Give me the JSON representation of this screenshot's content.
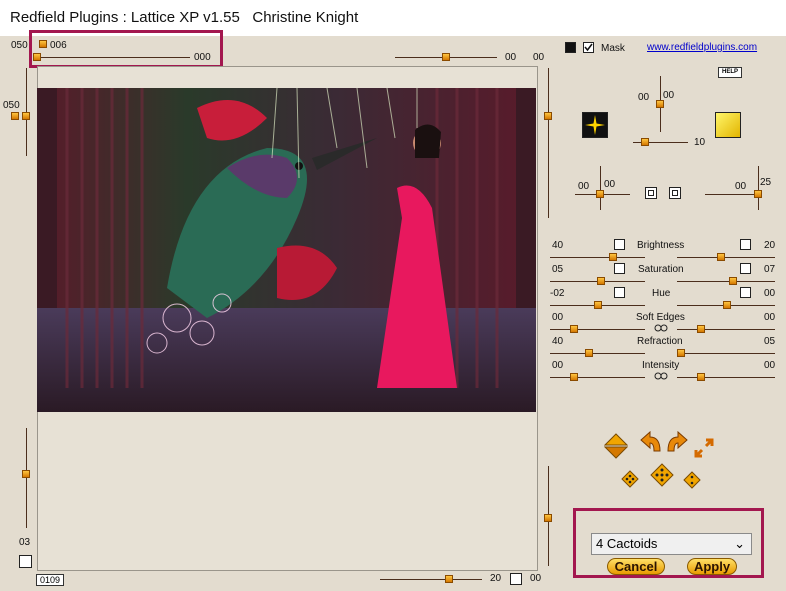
{
  "window": {
    "title": "Redfield Plugins : Lattice XP v1.55   Christine Knight"
  },
  "top_left": {
    "value_a": "050",
    "value_b": "006",
    "value_c": "000",
    "value_d": "050"
  },
  "top_slider": {
    "value_a": "00",
    "value_b": "00"
  },
  "mask": {
    "label": "Mask",
    "checked": true
  },
  "link": {
    "text": "www.redfieldplugins.com"
  },
  "help_label": "HELP",
  "light": {
    "value_a": "00",
    "value_b": "00",
    "value_c": "10",
    "value_d": "00",
    "value_e": "00",
    "value_f": "00",
    "value_g": "25"
  },
  "colors": {
    "accent": "#f0a500",
    "highlight": "#a3174f",
    "swatch_left": "#ffd400",
    "swatch_right": "#f2d21a"
  },
  "adjustments": [
    {
      "name": "Brightness",
      "left": "40",
      "right": "20"
    },
    {
      "name": "Saturation",
      "left": "05",
      "right": "07"
    },
    {
      "name": "Hue",
      "left": "-02",
      "right": "00"
    },
    {
      "name": "Soft Edges",
      "left": "00",
      "right": "00"
    },
    {
      "name": "Refraction",
      "left": "40",
      "right": "05"
    },
    {
      "name": "Intensity",
      "left": "00",
      "right": "00"
    }
  ],
  "left_bottom": {
    "value": "03"
  },
  "status": {
    "frame": "0109"
  },
  "bottom_slider": {
    "value_a": "20",
    "value_b": "00"
  },
  "preset": {
    "selected": "4 Cactoids"
  },
  "buttons": {
    "cancel": "Cancel",
    "apply": "Apply"
  },
  "icons": [
    "diamond-icon",
    "rotate-left-icon",
    "rotate-right-icon",
    "expand-arrows-icon",
    "dice-icon",
    "dice-icon",
    "dice-icon"
  ]
}
